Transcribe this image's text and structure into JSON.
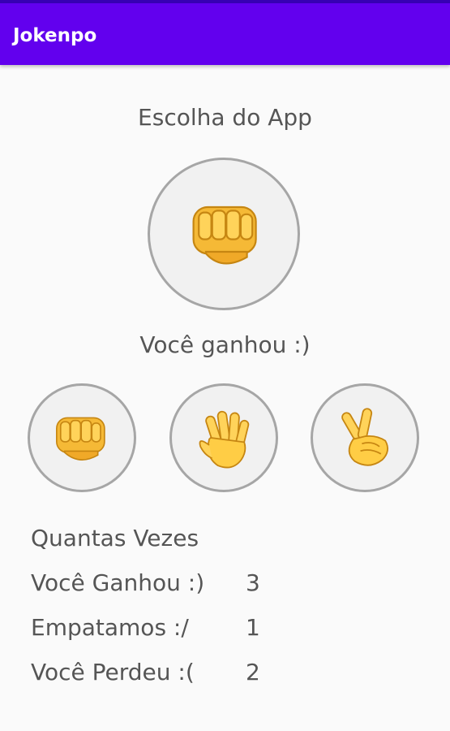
{
  "app_bar": {
    "title": "Jokenpo",
    "color": "#6200ee"
  },
  "app_choice": {
    "title": "Escolha do App",
    "selected_icon": "fist-icon"
  },
  "result": {
    "text": "Você ganhou :)"
  },
  "options": [
    {
      "icon": "fist-icon"
    },
    {
      "icon": "hand-icon"
    },
    {
      "icon": "victory-hand-icon"
    }
  ],
  "stats": {
    "header": "Quantas Vezes",
    "rows": [
      {
        "label": "Você Ganhou :)",
        "value": "3"
      },
      {
        "label": "Empatamos :/",
        "value": "1"
      },
      {
        "label": "Você Perdeu :(",
        "value": "2"
      }
    ]
  }
}
